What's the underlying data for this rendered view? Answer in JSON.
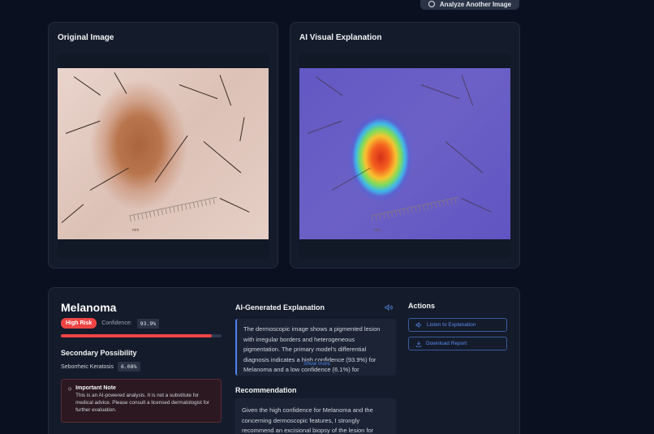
{
  "header": {
    "analyze_another_label": "Analyze Another Image",
    "analyze_icon": "refresh-icon"
  },
  "original_panel": {
    "title": "Original Image",
    "ruler_label": "mm"
  },
  "explanation_panel": {
    "title": "AI Visual Explanation",
    "ruler_label": "mm"
  },
  "result": {
    "diagnosis": "Melanoma",
    "risk_badge": "High Risk",
    "confidence_label": "Confidence:",
    "confidence_value": "93.9%",
    "confidence_fraction": 0.939,
    "secondary_title": "Secondary Possibility",
    "secondary_name": "Seborrheic Keratosis",
    "secondary_value": "6.08%",
    "note_title": "Important Note",
    "note_text": "This is an AI-powered analysis. It is not a substitute for medical advice. Please consult a licensed dermatologist for further evaluation."
  },
  "ai_explanation": {
    "title": "AI-Generated Explanation",
    "text": "The dermoscopic image shows a pigmented lesion with irregular borders and heterogeneous pigmentation. The primary model's differential diagnosis indicates a high confidence (93.9%) for Melanoma and a low confidence (6.1%) for",
    "show_more": "Show more",
    "recommendation_title": "Recommendation",
    "recommendation_text": "Given the high confidence for Melanoma and the concerning dermoscopic features, I strongly recommend an excisional biopsy of the lesion for"
  },
  "actions": {
    "title": "Actions",
    "listen_label": "Listen to Explanation",
    "download_label": "Download Report"
  },
  "colors": {
    "accent": "#4f83f1",
    "risk": "#ef4444",
    "background": "#0b1020",
    "card": "#141b2b"
  }
}
